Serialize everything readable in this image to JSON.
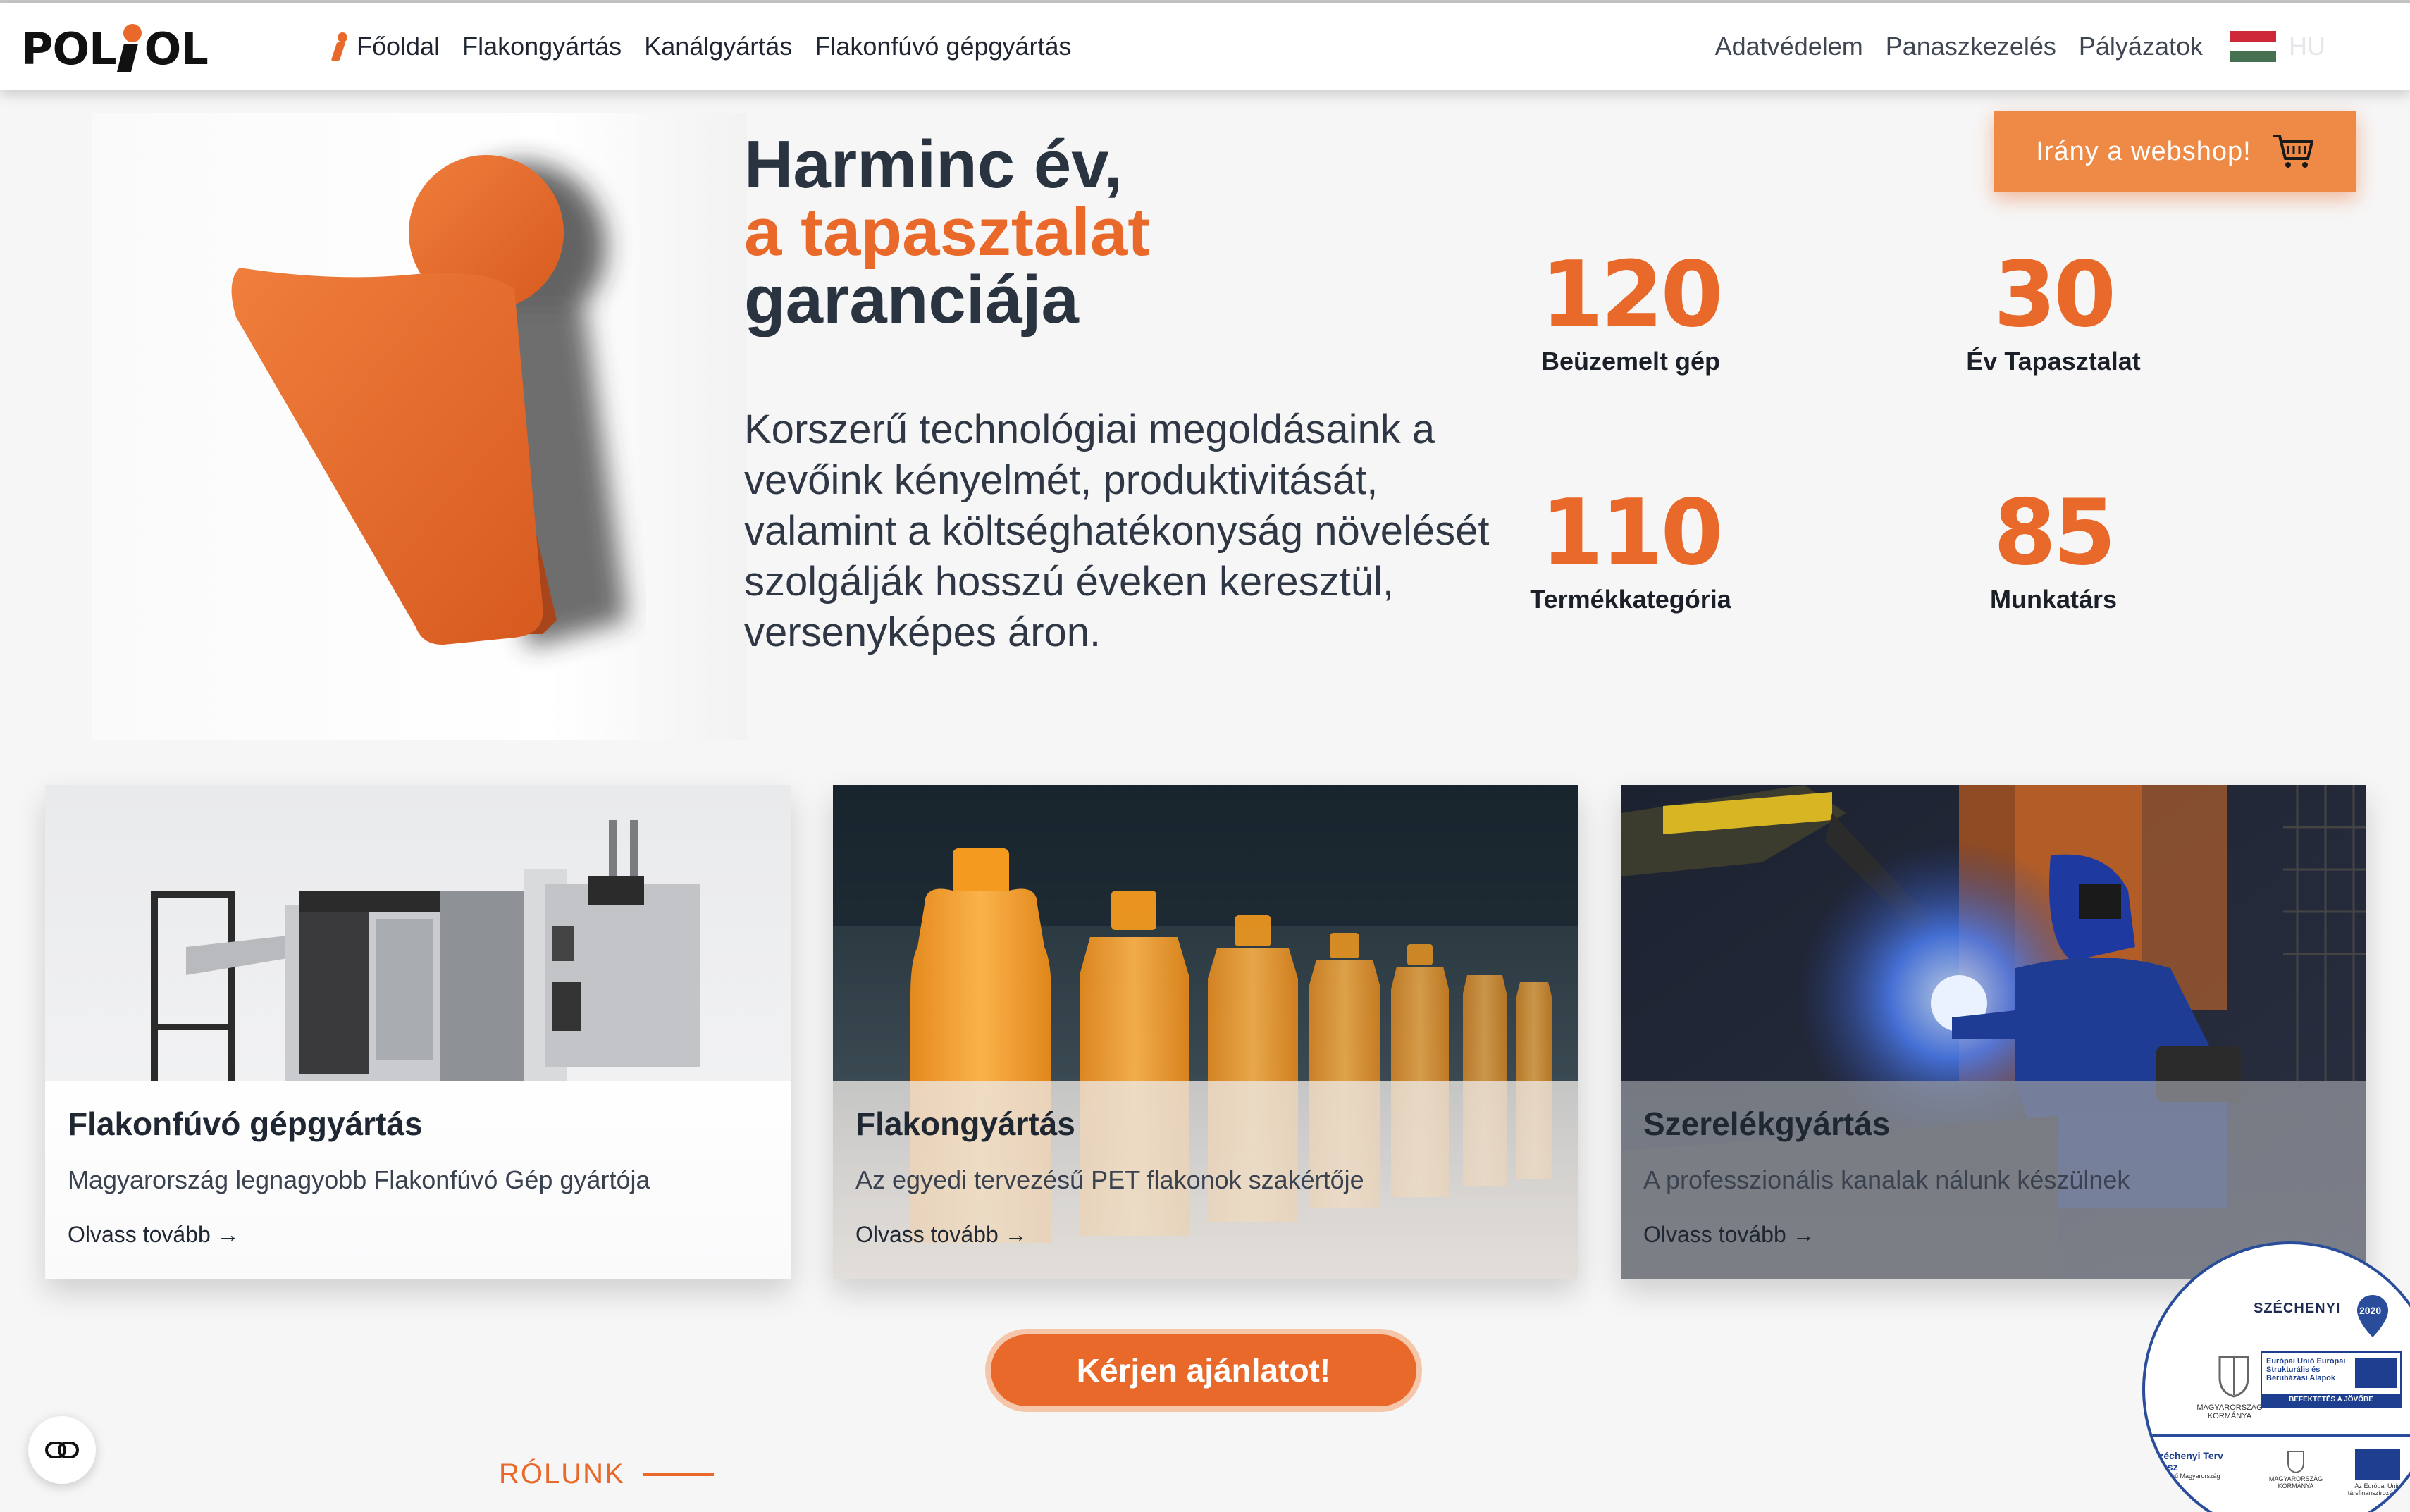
{
  "nav": {
    "logo_text_left": "POL",
    "logo_text_right": "OL",
    "left_links": [
      "Főoldal",
      "Flakongyártás",
      "Kanálgyártás",
      "Flakonfúvó gépgyártás"
    ],
    "right_links": [
      "Adatvédelem",
      "Panaszkezelés",
      "Pályázatok"
    ],
    "language": "HU",
    "flag_colors": [
      "#ce2939",
      "#ffffff",
      "#477050"
    ]
  },
  "hero": {
    "title_line1": "Harminc év,",
    "title_line2": "a tapasztalat",
    "title_line3": "garanciája",
    "text": "Korszerű technológiai megoldásaink a vevőink kényelmét, produktivitását, valamint a költséghatékonyság növelését szolgálják hosszú éveken keresztül, versenyképes áron."
  },
  "webshop_button": {
    "label": "Irány a webshop!",
    "icon": "shopping-cart-icon"
  },
  "stats": [
    {
      "value": "120",
      "label": "Beüzemelt gép"
    },
    {
      "value": "30",
      "label": "Év Tapasztalat"
    },
    {
      "value": "110",
      "label": "Termékkategória"
    },
    {
      "value": "85",
      "label": "Munkatárs"
    }
  ],
  "cards": [
    {
      "title": "Flakonfúvó gépgyártás",
      "subtitle": "Magyarország legnagyobb Flakonfúvó Gép gyártója",
      "link": "Olvass tovább →"
    },
    {
      "title": "Flakongyártás",
      "subtitle": "Az egyedi tervezésű PET flakonok szakértője",
      "link": "Olvass tovább →"
    },
    {
      "title": "Szerelékgyártás",
      "subtitle": "A professzionális kanalak nálunk készülnek",
      "link": "Olvass tovább →"
    }
  ],
  "cta": {
    "label": "Kérjen ajánlatot!"
  },
  "about": {
    "label": "RÓLUNK"
  },
  "cookie_button": {
    "icon": "cookie-settings-icon"
  },
  "badge": {
    "title": "SZÉCHENYI",
    "year": "2020",
    "hu_gov": "MAGYARORSZÁG KORMÁNYA",
    "eu_text": "Európai Unió Európai Strukturális és Beruházási Alapok",
    "eu_bar": "BEFEKTETÉS A JÖVŐBE",
    "plan": "Széchenyi Terv Plusz",
    "plan_sub": "Sokszínű Magyarország",
    "hu_gov2": "MAGYARORSZÁG KORMÁNYA",
    "eu2": "Az Európai Unió társfinanszírozásával"
  },
  "colors": {
    "accent": "#e8692a",
    "dark": "#2a3340",
    "badge_blue": "#2a4d9b"
  }
}
